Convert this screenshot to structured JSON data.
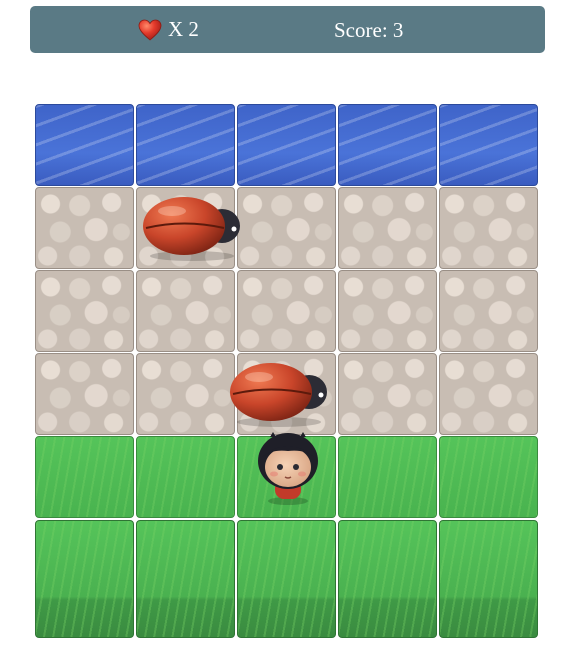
{
  "hud": {
    "heart_icon": "heart-icon",
    "lives_label": "X 2",
    "score_label": "Score: 3"
  },
  "board": {
    "columns": 5,
    "rows": [
      "water",
      "stone",
      "stone",
      "stone",
      "grass",
      "grass"
    ]
  },
  "sprites": {
    "enemies": [
      {
        "name": "ladybug-enemy",
        "row": 1,
        "col": 1
      },
      {
        "name": "ladybug-enemy",
        "row": 3,
        "col": 2
      }
    ],
    "player": {
      "name": "boy-player",
      "row": 4,
      "col": 2
    }
  },
  "colors": {
    "hud_background": "#5a7a85",
    "hud_text": "#ffffff",
    "heart": "#e53b2c",
    "water": "#4a73d8",
    "grass": "#55c45a",
    "stone": "#c8bdb3",
    "bug_shell": "#c9452a"
  }
}
